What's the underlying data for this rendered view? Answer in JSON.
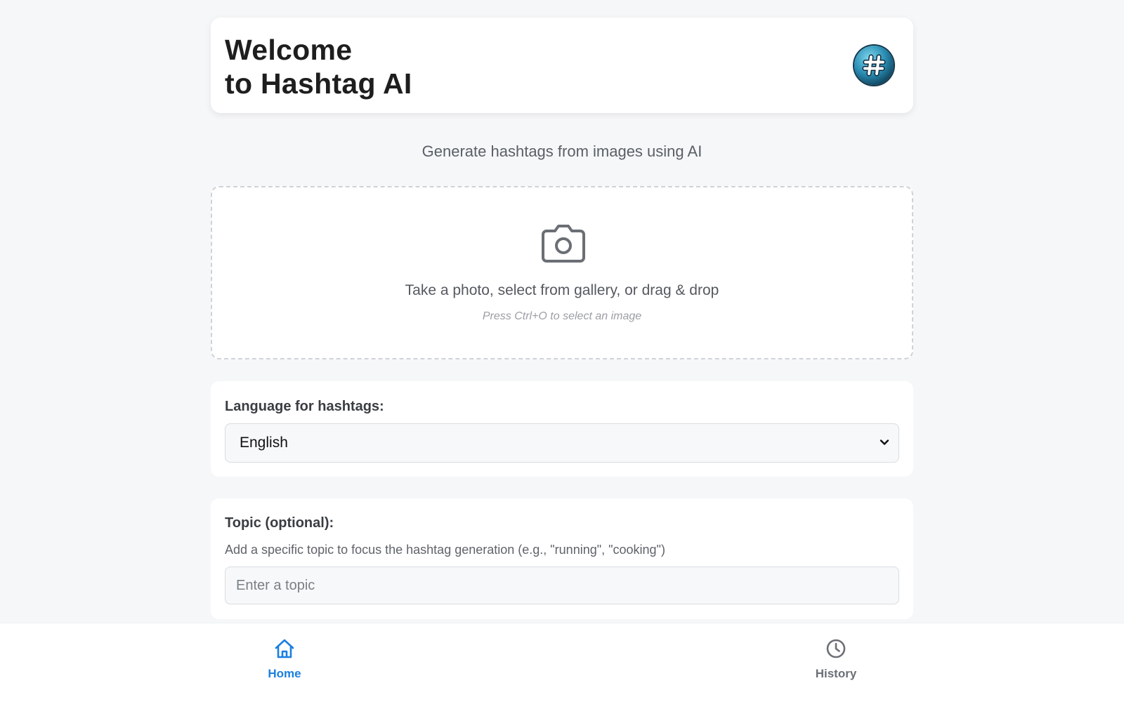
{
  "header": {
    "title_line1": "Welcome",
    "title_line2": "to Hashtag AI",
    "logo_icon": "hashtag-logo-icon"
  },
  "subtitle": "Generate hashtags from images using AI",
  "upload": {
    "icon": "camera-icon",
    "text": "Take a photo, select from gallery, or drag & drop",
    "hint": "Press Ctrl+O to select an image"
  },
  "language": {
    "label": "Language for hashtags:",
    "selected": "English"
  },
  "topic": {
    "label": "Topic (optional):",
    "help": "Add a specific topic to focus the hashtag generation (e.g., \"running\", \"cooking\")",
    "placeholder": "Enter a topic",
    "value": ""
  },
  "nav": {
    "home_label": "Home",
    "history_label": "History",
    "active": "home"
  },
  "colors": {
    "accent": "#1a7fe0",
    "background": "#f6f7f9",
    "inactive": "#6b6f75"
  }
}
